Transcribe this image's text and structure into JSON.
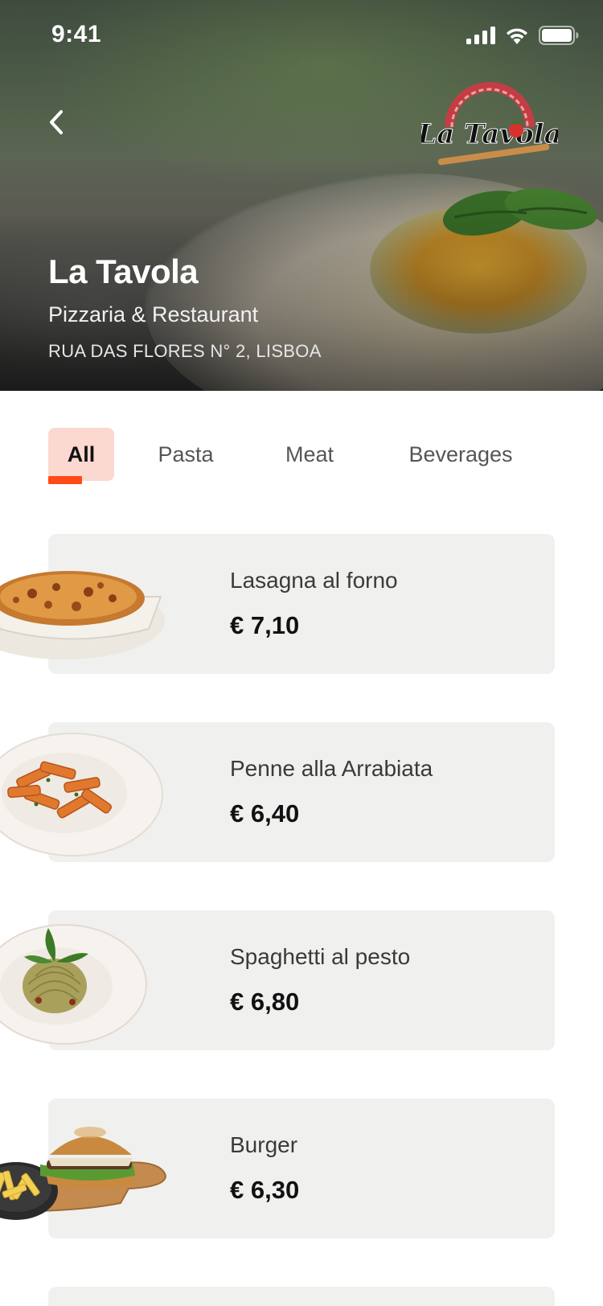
{
  "status": {
    "time": "9:41"
  },
  "restaurant": {
    "name": "La Tavola",
    "subtitle": "Pizzaria & Restaurant",
    "address": "RUA DAS FLORES N° 2, LISBOA",
    "logo_text": "La Tavola"
  },
  "tabs": [
    {
      "label": "All",
      "active": true
    },
    {
      "label": "Pasta",
      "active": false
    },
    {
      "label": "Meat",
      "active": false
    },
    {
      "label": "Beverages",
      "active": false
    }
  ],
  "menu": [
    {
      "name": "Lasagna al forno",
      "price": "€ 7,10"
    },
    {
      "name": "Penne alla Arrabiata",
      "price": "€ 6,40"
    },
    {
      "name": "Spaghetti al pesto",
      "price": "€ 6,80"
    },
    {
      "name": "Burger",
      "price": "€ 6,30"
    }
  ],
  "colors": {
    "accent": "#ff4a17",
    "active_tab_bg": "#fbd8d0",
    "card_bg": "#f0f1ef"
  },
  "icons": {
    "back": "chevron-left-icon",
    "signal": "cellular-signal-icon",
    "wifi": "wifi-icon",
    "battery": "battery-icon"
  }
}
